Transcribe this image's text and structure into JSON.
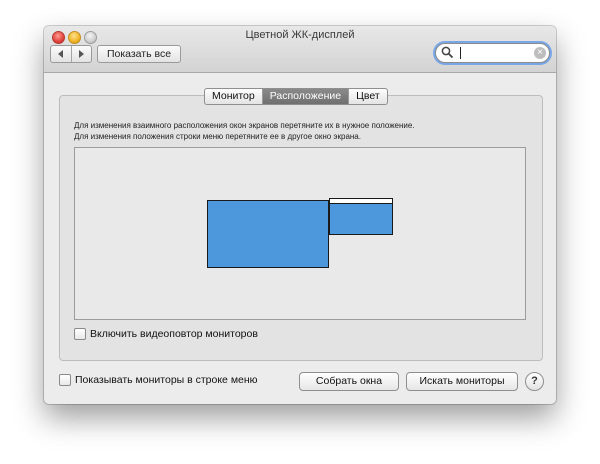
{
  "window": {
    "title": "Цветной ЖК-дисплей"
  },
  "toolbar": {
    "show_all_label": "Показать все",
    "search_value": "",
    "back_icon": "chevron-left-icon",
    "forward_icon": "chevron-right-icon",
    "search_icon": "magnifier-icon",
    "clear_icon": "clear-x-icon"
  },
  "tabs": [
    {
      "label": "Монитор",
      "selected": false
    },
    {
      "label": "Расположение",
      "selected": true
    },
    {
      "label": "Цвет",
      "selected": false
    }
  ],
  "arrangement": {
    "instruction_line1": "Для изменения взаимного расположения окон экранов перетяните их в нужное положение.",
    "instruction_line2": "Для изменения положения строки меню перетяните ее в другое окно экрана.",
    "display_color": "#4d97dd",
    "mirror_checkbox_label": "Включить видеоповтор мониторов",
    "mirror_checked": false
  },
  "footer": {
    "show_in_menu_label": "Показывать мониторы в строке меню",
    "show_in_menu_checked": false,
    "gather_windows_label": "Собрать окна",
    "detect_displays_label": "Искать мониторы",
    "help_label": "?"
  }
}
